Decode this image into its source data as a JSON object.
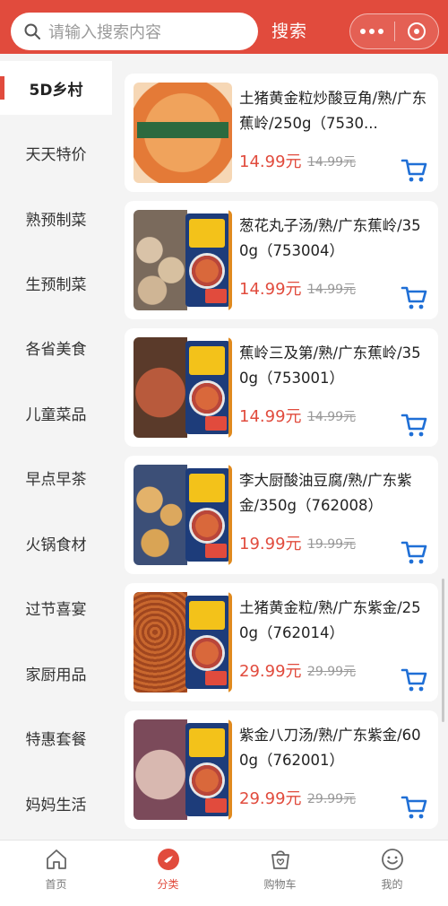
{
  "search": {
    "placeholder": "请输入搜索内容",
    "button_label": "搜索"
  },
  "categories": [
    {
      "label": "5D乡村",
      "active": true
    },
    {
      "label": "天天特价",
      "active": false
    },
    {
      "label": "熟预制菜",
      "active": false
    },
    {
      "label": "生预制菜",
      "active": false
    },
    {
      "label": "各省美食",
      "active": false
    },
    {
      "label": "儿童菜品",
      "active": false
    },
    {
      "label": "早点早茶",
      "active": false
    },
    {
      "label": "火锅食材",
      "active": false
    },
    {
      "label": "过节喜宴",
      "active": false
    },
    {
      "label": "家厨用品",
      "active": false
    },
    {
      "label": "特惠套餐",
      "active": false
    },
    {
      "label": "妈妈生活",
      "active": false
    }
  ],
  "products": [
    {
      "name": "土猪黄金粒炒酸豆角/熟/广东蕉岭/250g（7530...",
      "price": "14.99元",
      "old_price": "14.99元"
    },
    {
      "name": "葱花丸子汤/熟/广东蕉岭/350g（753004）",
      "price": "14.99元",
      "old_price": "14.99元"
    },
    {
      "name": "蕉岭三及第/熟/广东蕉岭/350g（753001）",
      "price": "14.99元",
      "old_price": "14.99元"
    },
    {
      "name": "李大厨酸油豆腐/熟/广东紫金/350g（762008）",
      "price": "19.99元",
      "old_price": "19.99元"
    },
    {
      "name": "土猪黄金粒/熟/广东紫金/250g（762014）",
      "price": "29.99元",
      "old_price": "29.99元"
    },
    {
      "name": "紫金八刀汤/熟/广东紫金/600g（762001）",
      "price": "29.99元",
      "old_price": "29.99元"
    }
  ],
  "tabbar": [
    {
      "label": "首页",
      "icon": "home-icon",
      "active": false
    },
    {
      "label": "分类",
      "icon": "category-icon",
      "active": true
    },
    {
      "label": "购物车",
      "icon": "cart-icon",
      "active": false
    },
    {
      "label": "我的",
      "icon": "profile-icon",
      "active": false
    }
  ],
  "colors": {
    "accent": "#e14b3d",
    "cart_blue": "#1f6fd6"
  }
}
